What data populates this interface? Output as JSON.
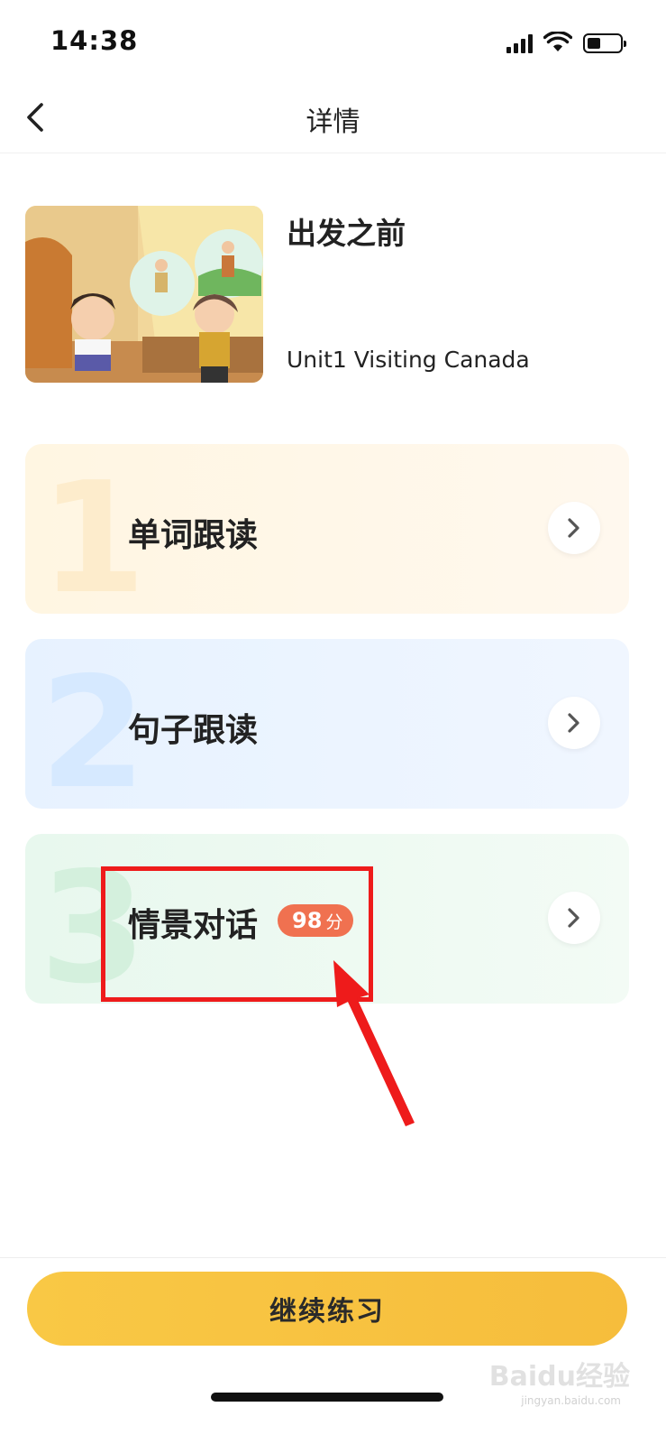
{
  "status_bar": {
    "time": "14:38",
    "signal_icon": "cellular-signal",
    "wifi_icon": "wifi",
    "battery_icon": "battery-low"
  },
  "nav": {
    "title": "详情",
    "back_icon": "chevron-left"
  },
  "lesson": {
    "title": "出发之前",
    "subtitle": "Unit1 Visiting Canada"
  },
  "cards": [
    {
      "number": "1",
      "label": "单词跟读"
    },
    {
      "number": "2",
      "label": "句子跟读"
    },
    {
      "number": "3",
      "label": "情景对话",
      "score": "98",
      "score_unit": "分"
    }
  ],
  "continue_button": {
    "label": "继续练习"
  },
  "watermark": {
    "text": "Baidu经验",
    "sub": "jingyan.baidu.com"
  },
  "colors": {
    "accent_yellow": "#f7c243",
    "score_badge": "#f07150",
    "annotation_red": "#ee1b1b",
    "card1_bg": "#fff6e2",
    "card2_bg": "#e7f2ff",
    "card3_bg": "#e8f8ee"
  }
}
